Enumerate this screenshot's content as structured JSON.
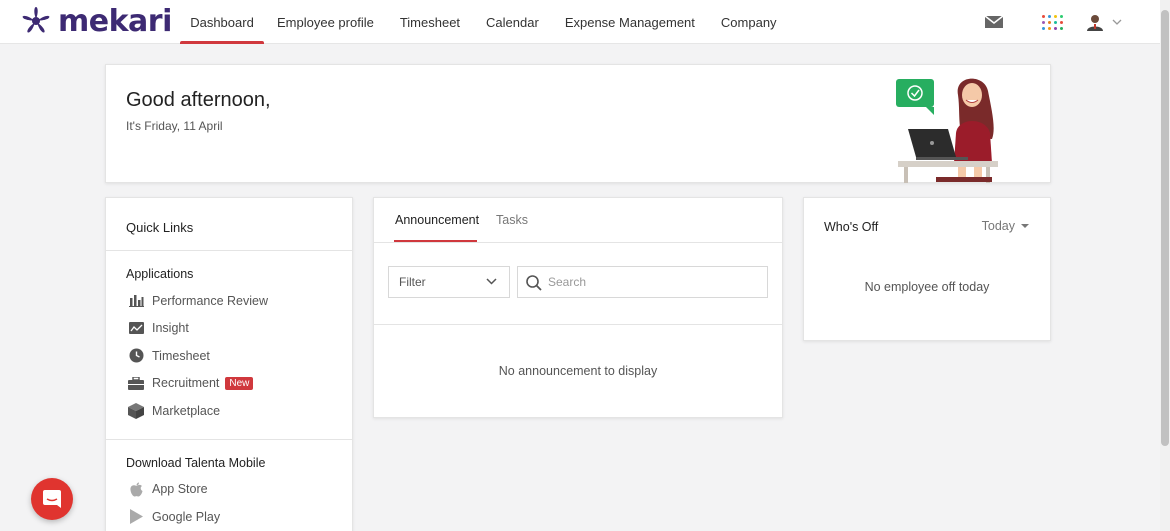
{
  "brand": {
    "name": "mekari",
    "color": "#3d2a73"
  },
  "nav": {
    "items": [
      {
        "label": "Dashboard",
        "active": true
      },
      {
        "label": "Employee profile",
        "active": false
      },
      {
        "label": "Timesheet",
        "active": false
      },
      {
        "label": "Calendar",
        "active": false
      },
      {
        "label": "Expense Management",
        "active": false
      },
      {
        "label": "Company",
        "active": false
      }
    ],
    "icons": {
      "mail": "mail-icon",
      "apps": "apps-grid-icon",
      "avatar": "user-avatar-icon",
      "dropdown": "chevron-down-icon"
    }
  },
  "greeting": {
    "title": "Good afternoon,",
    "date": "It's Friday, 11 April"
  },
  "quick_links": {
    "title": "Quick Links",
    "applications_title": "Applications",
    "applications": [
      {
        "label": "Performance Review",
        "icon": "bar-chart-icon"
      },
      {
        "label": "Insight",
        "icon": "insight-icon"
      },
      {
        "label": "Timesheet",
        "icon": "clock-icon"
      },
      {
        "label": "Recruitment",
        "icon": "briefcase-icon",
        "badge": "New"
      },
      {
        "label": "Marketplace",
        "icon": "cube-icon"
      }
    ],
    "download_title": "Download Talenta Mobile",
    "downloads": [
      {
        "label": "App Store",
        "icon": "apple-icon"
      },
      {
        "label": "Google Play",
        "icon": "play-icon"
      }
    ]
  },
  "announcement": {
    "tabs": [
      {
        "label": "Announcement",
        "active": true
      },
      {
        "label": "Tasks",
        "active": false
      }
    ],
    "filter_label": "Filter",
    "search_placeholder": "Search",
    "empty": "No announcement to display"
  },
  "whos_off": {
    "title": "Who's Off",
    "period": "Today",
    "empty": "No employee off today"
  },
  "colors": {
    "accent": "#d0383d",
    "chat": "#e0342f",
    "background": "#f3f3f4"
  }
}
